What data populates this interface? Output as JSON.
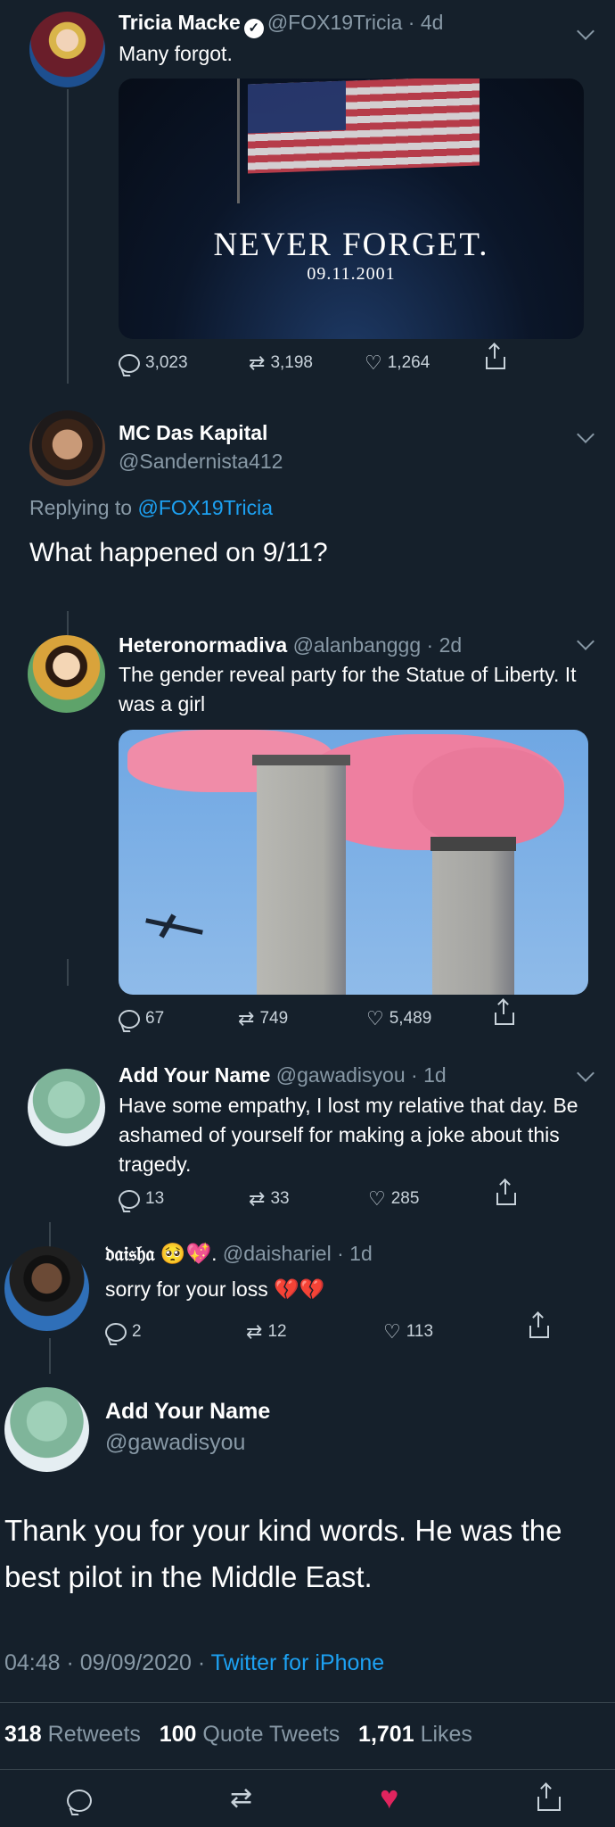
{
  "tweet1": {
    "name": "Tricia Macke",
    "handle": "@FOX19Tricia",
    "time": "4d",
    "text": "Many forgot.",
    "image": {
      "line1": "NEVER FORGET.",
      "line2": "09.11.2001"
    },
    "replies": "3,023",
    "retweets": "3,198",
    "likes": "1,264"
  },
  "tweet2": {
    "name": "MC Das Kapital",
    "handle": "@Sandernista412",
    "replying_prefix": "Replying to",
    "replying_to": "@FOX19Tricia",
    "text": "What happened on 9/11?"
  },
  "tweet3": {
    "name": "Heteronormadiva",
    "handle": "@alanbanggg",
    "time": "2d",
    "text": "The gender reveal party for the Statue of Liberty. It was a girl",
    "replies": "67",
    "retweets": "749",
    "likes": "5,489"
  },
  "tweet4": {
    "name": "Add Your Name",
    "handle": "@gawadisyou",
    "time": "1d",
    "text": "Have some empathy, I lost my relative that day.  Be ashamed of yourself for making a joke about this tragedy.",
    "replies": "13",
    "retweets": "33",
    "likes": "285"
  },
  "tweet5": {
    "name": "𝔡𝔞𝔦𝔰𝔥𝔞",
    "emoji": "🥺💖.",
    "handle": "@daishariel",
    "time": "1d",
    "text": "sorry for your loss 💔💔",
    "replies": "2",
    "retweets": "12",
    "likes": "113"
  },
  "main_tweet": {
    "name": "Add Your Name",
    "handle": "@gawadisyou",
    "text": "Thank you for your kind words. He was the best pilot in the Middle East.",
    "time": "04:48",
    "date": "09/09/2020",
    "source": "Twitter for iPhone",
    "retweets": "318",
    "retweets_label": "Retweets",
    "quotes": "100",
    "quotes_label": "Quote Tweets",
    "likes": "1,701",
    "likes_label": "Likes"
  },
  "colors": {
    "background": "#15202b",
    "accent": "#1da1f2",
    "like": "#e0245e"
  }
}
